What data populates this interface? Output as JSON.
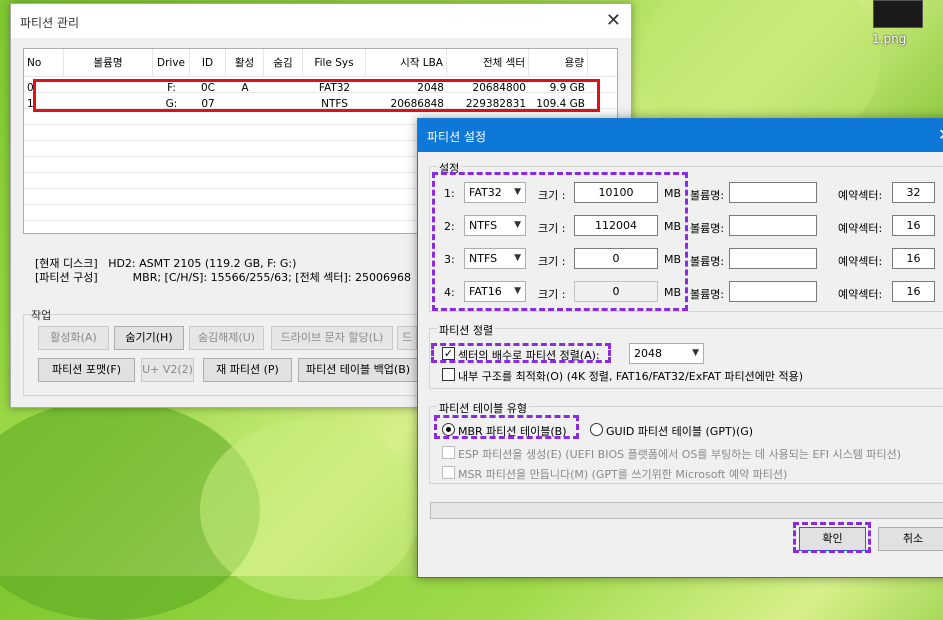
{
  "desktop": {
    "icon_label": "1.png"
  },
  "main_window": {
    "title": "파티션 관리",
    "columns": [
      "No",
      "볼륨명",
      "Drive",
      "ID",
      "활성",
      "숨김",
      "File Sys",
      "시작 LBA",
      "전체 섹터",
      "용량"
    ],
    "rows": [
      [
        "0",
        "",
        "F:",
        "0C",
        "A",
        "",
        "FAT32",
        "2048",
        "20684800",
        "9.9 GB"
      ],
      [
        "1",
        "",
        "G:",
        "07",
        "",
        "",
        "NTFS",
        "20686848",
        "229382831",
        "109.4 GB"
      ]
    ],
    "current_disk_label": "[현재 디스크]",
    "current_disk_value": "HD2: ASMT 2105 (119.2 GB, F: G:)",
    "partition_config_label": "[파티션 구성]",
    "partition_config_value": "MBR;     [C/H/S]: 15566/255/63; [전체 섹터]: 25006968",
    "group_label": "작업",
    "buttons": {
      "activate": "활성화(A)",
      "hide": "숨기기(H)",
      "unhide": "숨김해제(U)",
      "drive_letter": "드라이브 문자 할당(L)",
      "cut": "드",
      "format": "파티션 포맷(F)",
      "uv2": "U+ V2(2)",
      "repartition": "재 파티션 (P)",
      "backup": "파티션 테이블 백업(B)"
    }
  },
  "dialog": {
    "title": "파티션 설정",
    "settings_label": "설정",
    "size_label": "크기 :",
    "unit": "MB",
    "volume_label": "볼륨명:",
    "reserved_label": "예약섹터:",
    "partitions": [
      {
        "num": "1:",
        "fs": "FAT32",
        "size": "10100",
        "volume": "",
        "reserved": "32"
      },
      {
        "num": "2:",
        "fs": "NTFS",
        "size": "112004",
        "volume": "",
        "reserved": "16"
      },
      {
        "num": "3:",
        "fs": "NTFS",
        "size": "0",
        "volume": "",
        "reserved": "16"
      },
      {
        "num": "4:",
        "fs": "FAT16",
        "size": "0",
        "volume": "",
        "reserved": "16"
      }
    ],
    "alignment_label": "파티션 정렬",
    "align_checkbox": "섹터의 배수로 파티션 정렬(A):",
    "align_checked": true,
    "align_value": "2048",
    "optimize_checkbox": "내부 구조를 최적화(O) (4K 정렬, FAT16/FAT32/ExFAT 파티션에만 적용)",
    "table_type_label": "파티션 테이블 유형",
    "mbr_radio": "MBR 파티션 테이블(B)",
    "gpt_radio": "GUID 파티션 테이블 (GPT)(G)",
    "esp_checkbox": "ESP 파티션을 생성(E) (UEFI BIOS 플랫폼에서 OS를 부팅하는 데 사용되는 EFI 시스템 파티션)",
    "msr_checkbox": "MSR 파티션을 만듭니다(M) (GPT를 쓰기위한 Microsoft 예약 파티션)",
    "ok": "확인",
    "cancel": "취소"
  }
}
